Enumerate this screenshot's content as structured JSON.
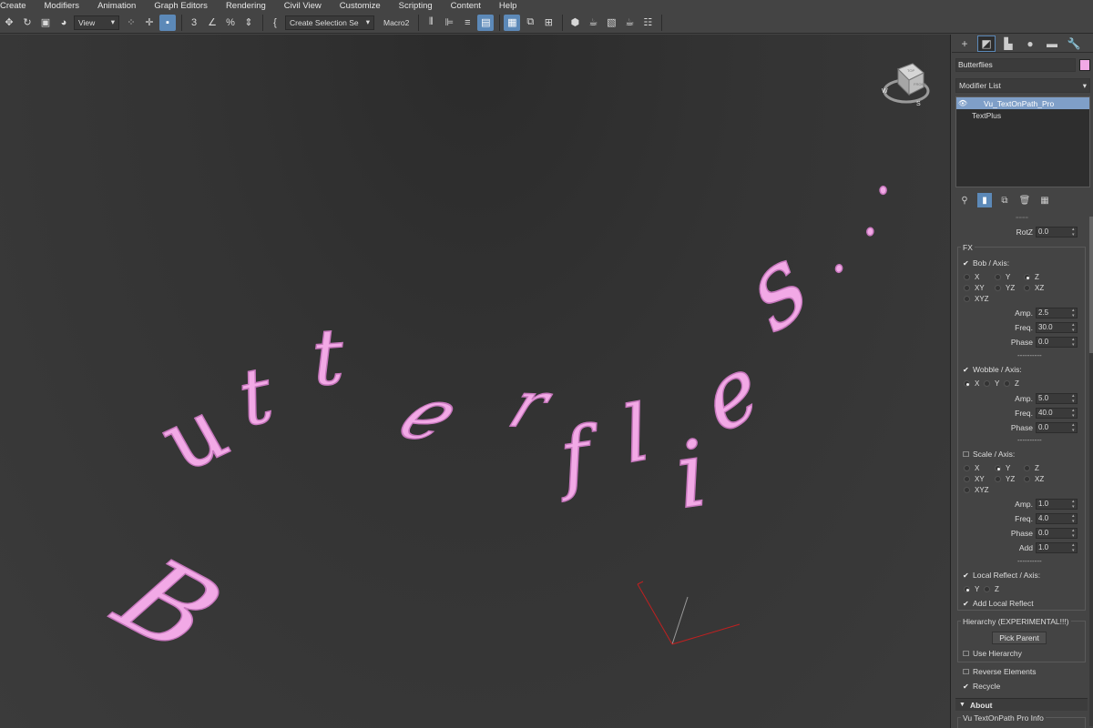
{
  "menu": [
    "Create",
    "Modifiers",
    "Animation",
    "Graph Editors",
    "Rendering",
    "Civil View",
    "Customize",
    "Scripting",
    "Content",
    "Help"
  ],
  "toolbar": {
    "view_combo": "View",
    "selection_set_combo": "Create Selection Se",
    "macro_label": "Macro2",
    "snap_label": "3",
    "percent_label": "%"
  },
  "viewport": {
    "text_glyphs": [
      "B",
      "u",
      "t",
      "t",
      "e",
      "r",
      "f",
      "l",
      "i",
      "e",
      "s",
      ".",
      ".",
      "."
    ],
    "viewcube_labels": {
      "top": "TOP",
      "front": "FRONT",
      "w": "W",
      "s": "S"
    }
  },
  "panel": {
    "object_name": "Butterflies",
    "object_color": "#f2a9e6",
    "modifier_list_label": "Modifier List",
    "stack": [
      "Vu_TextOnPath_Pro",
      "TextPlus"
    ],
    "rotz": {
      "label": "RotZ",
      "value": "0.0"
    },
    "fx_title": "FX",
    "bob": {
      "label": "Bob / Axis:",
      "checked": true,
      "radios": [
        "X",
        "Y",
        "Z",
        "XY",
        "YZ",
        "XZ",
        "XYZ"
      ],
      "selected": "Z",
      "amp": {
        "label": "Amp.",
        "value": "2.5"
      },
      "freq": {
        "label": "Freq.",
        "value": "30.0"
      },
      "phase": {
        "label": "Phase",
        "value": "0.0"
      }
    },
    "wobble": {
      "label": "Wobble / Axis:",
      "checked": true,
      "radios": [
        "X",
        "Y",
        "Z"
      ],
      "selected": "X",
      "amp": {
        "label": "Amp.",
        "value": "5.0"
      },
      "freq": {
        "label": "Freq.",
        "value": "40.0"
      },
      "phase": {
        "label": "Phase",
        "value": "0.0"
      }
    },
    "scale": {
      "label": "Scale / Axis:",
      "checked": false,
      "radios": [
        "X",
        "Y",
        "Z",
        "XY",
        "YZ",
        "XZ",
        "XYZ"
      ],
      "selected": "Y",
      "amp": {
        "label": "Amp.",
        "value": "1.0"
      },
      "freq": {
        "label": "Freq.",
        "value": "4.0"
      },
      "phase": {
        "label": "Phase",
        "value": "0.0"
      },
      "add": {
        "label": "Add",
        "value": "1.0"
      }
    },
    "separator": "----------",
    "local_reflect": {
      "label": "Local Reflect / Axis:",
      "checked": true,
      "radios": [
        "Y",
        "Z"
      ],
      "selected": "Y",
      "add_label": "Add Local Reflect",
      "add_checked": true
    },
    "hierarchy": {
      "title": "Hierarchy (EXPERIMENTAL!!!)",
      "pick_parent": "Pick Parent",
      "use_hierarchy": "Use Hierarchy"
    },
    "reverse_elements": "Reverse Elements",
    "recycle": "Recycle",
    "about_title": "About",
    "info_title": "Vu TextOnPath Pro Info"
  }
}
